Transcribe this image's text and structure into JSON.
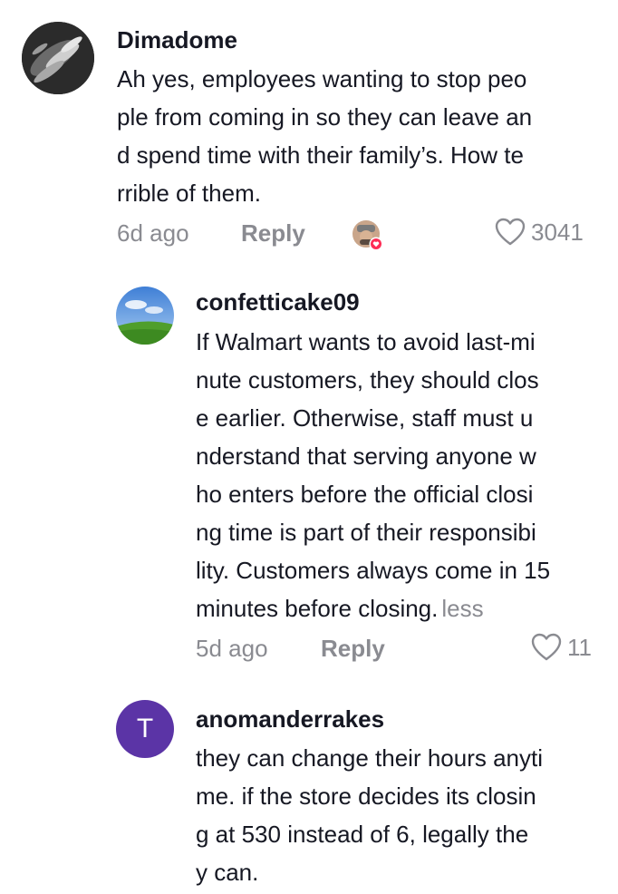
{
  "comments": [
    {
      "username": "Dimadome",
      "lines": [
        "Ah yes, employees wanting to stop peo",
        "ple from coming in so they can leave an",
        "d spend time with their family’s. How te",
        "rrible of them."
      ],
      "time": "6d ago",
      "reply_label": "Reply",
      "likes": "3041",
      "avatar_icon": "dark-abstract-avatar",
      "creator_liked_icon": "creator-liked-badge-icon"
    },
    {
      "username": "confetticake09",
      "lines": [
        "If Walmart wants to avoid last-mi",
        "nute customers, they should clos",
        "e earlier. Otherwise, staff must u",
        "nderstand that serving anyone w",
        "ho enters before the official closi",
        "ng time is part of their responsibi",
        "lity. Customers always come in 15",
        "minutes before closing."
      ],
      "less_label": "less",
      "time": "5d ago",
      "reply_label": "Reply",
      "likes": "11",
      "avatar_icon": "sky-field-avatar"
    },
    {
      "username": "anomanderrakes",
      "avatar_letter": "T",
      "avatar_color": "#5b34a6",
      "lines": [
        "they can change their hours anyti",
        "me. if the store decides its closin",
        "g at 530 instead of 6, legally the",
        "y can."
      ]
    }
  ],
  "colors": {
    "text": "#161823",
    "muted": "#8a8b91",
    "liked_badge": "#fe2c55"
  }
}
